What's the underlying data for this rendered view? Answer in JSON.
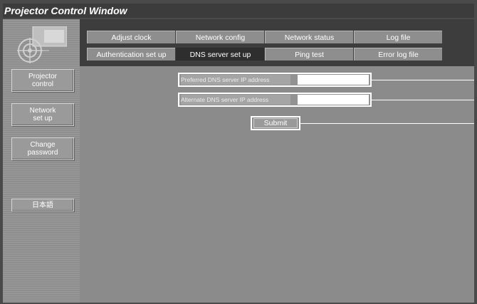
{
  "window": {
    "title": "Projector Control Window"
  },
  "sidebar": {
    "items": [
      {
        "label_line1": "Projector",
        "label_line2": "control"
      },
      {
        "label_line1": "Network",
        "label_line2": "set up"
      },
      {
        "label_line1": "Change",
        "label_line2": "password"
      },
      {
        "label": "日本語"
      }
    ]
  },
  "tabs": [
    {
      "label": "Adjust clock"
    },
    {
      "label": "Network config"
    },
    {
      "label": "Network status"
    },
    {
      "label": "Log file"
    },
    {
      "label": "Authentication set up"
    },
    {
      "label": "DNS server set up",
      "active": true
    },
    {
      "label": "Ping test"
    },
    {
      "label": "Error log file"
    }
  ],
  "form": {
    "preferred_label": "Preferred DNS server IP address",
    "preferred_value": "",
    "alternate_label": "Alternate DNS server IP address",
    "alternate_value": "",
    "submit_label": "Submit"
  }
}
